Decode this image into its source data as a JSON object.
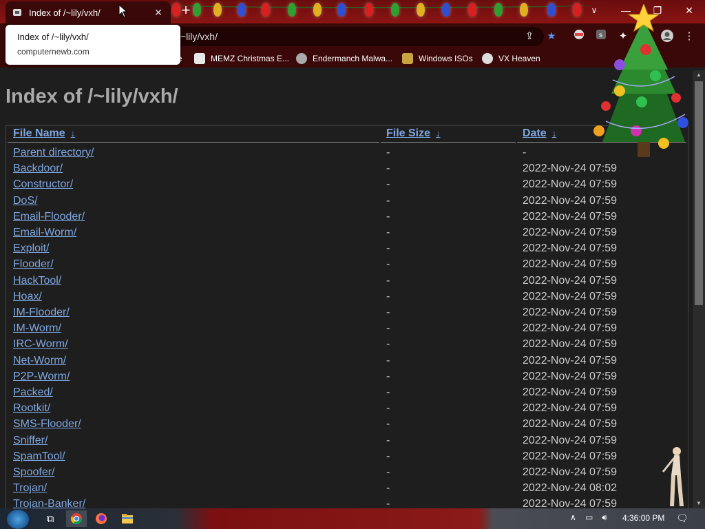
{
  "tab": {
    "title": "Index of /~lily/vxh/",
    "close": "✕",
    "new_tab": "+"
  },
  "window_controls": {
    "minimize": "—",
    "restore": "❐",
    "close": "✕",
    "tab_search": "∨"
  },
  "tooltip": {
    "title": "Index of /~lily/vxh/",
    "domain": "computernewb.com"
  },
  "omnibox": {
    "text": "/~lily/vxh/"
  },
  "bookmarks": [
    {
      "label": "e",
      "icon": "bookmark-icon"
    },
    {
      "label": "MEMZ Christmas E...",
      "icon": "memz-icon"
    },
    {
      "label": "Endermanch Malwa...",
      "icon": "raccoon-icon"
    },
    {
      "label": "Windows ISOs",
      "icon": "windows-icon"
    },
    {
      "label": "VX Heaven",
      "icon": "vx-icon"
    }
  ],
  "page": {
    "heading": "Index of /~lily/vxh/",
    "columns": {
      "name": "File Name",
      "size": "File Size",
      "date": "Date",
      "sort_arrow": "↓"
    },
    "rows": [
      {
        "name": "Parent directory/",
        "size": "-",
        "date": "-"
      },
      {
        "name": "Backdoor/",
        "size": "-",
        "date": "2022-Nov-24 07:59"
      },
      {
        "name": "Constructor/",
        "size": "-",
        "date": "2022-Nov-24 07:59"
      },
      {
        "name": "DoS/",
        "size": "-",
        "date": "2022-Nov-24 07:59"
      },
      {
        "name": "Email-Flooder/",
        "size": "-",
        "date": "2022-Nov-24 07:59"
      },
      {
        "name": "Email-Worm/",
        "size": "-",
        "date": "2022-Nov-24 07:59"
      },
      {
        "name": "Exploit/",
        "size": "-",
        "date": "2022-Nov-24 07:59"
      },
      {
        "name": "Flooder/",
        "size": "-",
        "date": "2022-Nov-24 07:59"
      },
      {
        "name": "HackTool/",
        "size": "-",
        "date": "2022-Nov-24 07:59"
      },
      {
        "name": "Hoax/",
        "size": "-",
        "date": "2022-Nov-24 07:59"
      },
      {
        "name": "IM-Flooder/",
        "size": "-",
        "date": "2022-Nov-24 07:59"
      },
      {
        "name": "IM-Worm/",
        "size": "-",
        "date": "2022-Nov-24 07:59"
      },
      {
        "name": "IRC-Worm/",
        "size": "-",
        "date": "2022-Nov-24 07:59"
      },
      {
        "name": "Net-Worm/",
        "size": "-",
        "date": "2022-Nov-24 07:59"
      },
      {
        "name": "P2P-Worm/",
        "size": "-",
        "date": "2022-Nov-24 07:59"
      },
      {
        "name": "Packed/",
        "size": "-",
        "date": "2022-Nov-24 07:59"
      },
      {
        "name": "Rootkit/",
        "size": "-",
        "date": "2022-Nov-24 07:59"
      },
      {
        "name": "SMS-Flooder/",
        "size": "-",
        "date": "2022-Nov-24 07:59"
      },
      {
        "name": "Sniffer/",
        "size": "-",
        "date": "2022-Nov-24 07:59"
      },
      {
        "name": "SpamTool/",
        "size": "-",
        "date": "2022-Nov-24 07:59"
      },
      {
        "name": "Spoofer/",
        "size": "-",
        "date": "2022-Nov-24 07:59"
      },
      {
        "name": "Trojan/",
        "size": "-",
        "date": "2022-Nov-24 08:02"
      },
      {
        "name": "Trojan-Banker/",
        "size": "-",
        "date": "2022-Nov-24 07:59"
      }
    ]
  },
  "taskbar": {
    "clock": "4:36:00 PM",
    "apps": [
      "chrome-icon",
      "firefox-icon",
      "file-explorer-icon"
    ]
  },
  "colors": {
    "link": "#7ea6e0",
    "text": "#cccccc",
    "heading": "#aaaaaa",
    "background": "#1e1e1e",
    "chrome_frame": "#3a0808"
  }
}
